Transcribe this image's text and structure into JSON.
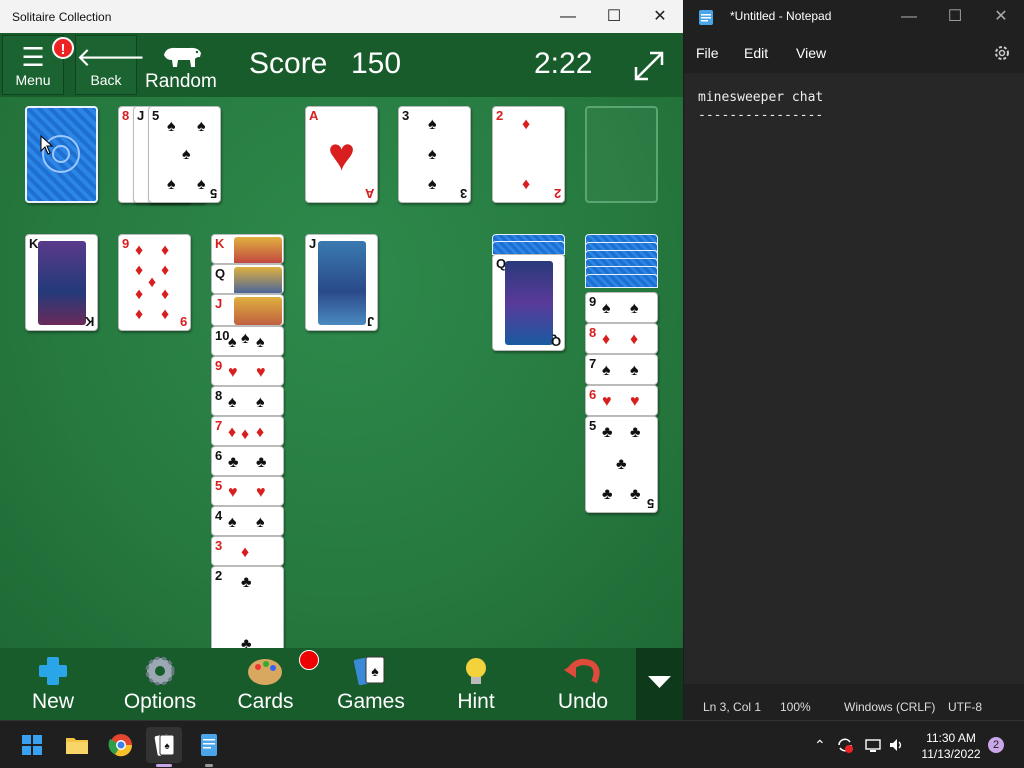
{
  "solitaire": {
    "window_title": "Solitaire Collection",
    "menu_label": "Menu",
    "alert_badge": "!",
    "back_label": "Back",
    "mode_label": "Random",
    "score_label": "Score",
    "score_value": "150",
    "timer": "2:22",
    "toolbar": {
      "new_label": "New",
      "options_label": "Options",
      "cards_label": "Cards",
      "games_label": "Games",
      "hint_label": "Hint",
      "undo_label": "Undo"
    },
    "waste_cards": [
      "8",
      "J",
      "5"
    ],
    "foundations": [
      {
        "rank": "A",
        "suit": "♥",
        "color": "red"
      },
      {
        "rank": "3",
        "suit": "♠",
        "color": "black"
      },
      {
        "rank": "2",
        "suit": "♦",
        "color": "red"
      },
      {
        "rank": "",
        "suit": "",
        "color": "empty"
      }
    ],
    "tableau": [
      {
        "cards": [
          {
            "rank": "K",
            "suit": "♠"
          }
        ]
      },
      {
        "cards": [
          {
            "rank": "9",
            "suit": "♦"
          }
        ]
      },
      {
        "cards": [
          {
            "rank": "K",
            "suit": "♦"
          },
          {
            "rank": "Q",
            "suit": "♣"
          },
          {
            "rank": "J",
            "suit": "♦"
          },
          {
            "rank": "10",
            "suit": "♠"
          },
          {
            "rank": "9",
            "suit": "♥"
          },
          {
            "rank": "8",
            "suit": "♠"
          },
          {
            "rank": "7",
            "suit": "♦"
          },
          {
            "rank": "6",
            "suit": "♣"
          },
          {
            "rank": "5",
            "suit": "♥"
          },
          {
            "rank": "4",
            "suit": "♠"
          },
          {
            "rank": "3",
            "suit": "♦"
          },
          {
            "rank": "2",
            "suit": "♣"
          }
        ]
      },
      {
        "cards": [
          {
            "rank": "J",
            "suit": "♣"
          }
        ]
      },
      {
        "cards": []
      },
      {
        "cards": [
          {
            "rank": "Q",
            "suit": "♣"
          }
        ]
      },
      {
        "cards": [
          {
            "rank": "9",
            "suit": "♠"
          },
          {
            "rank": "8",
            "suit": "♦"
          },
          {
            "rank": "7",
            "suit": "♠"
          },
          {
            "rank": "6",
            "suit": "♥"
          },
          {
            "rank": "5",
            "suit": "♣"
          }
        ]
      }
    ]
  },
  "notepad": {
    "window_title": "*Untitled - Notepad",
    "menu": [
      "File",
      "Edit",
      "View"
    ],
    "content": "minesweeper chat\n----------------",
    "status": {
      "position": "Ln 3, Col 1",
      "zoom": "100%",
      "line_ending": "Windows (CRLF)",
      "encoding": "UTF-8"
    }
  },
  "taskbar": {
    "time": "11:30 AM",
    "date": "11/13/2022",
    "notification_count": "2"
  },
  "colors": {
    "felt": "#2a7a44",
    "toolbar": "#185c2c",
    "red_suit": "#d81e1e",
    "card_back": "#1f6fd0"
  }
}
